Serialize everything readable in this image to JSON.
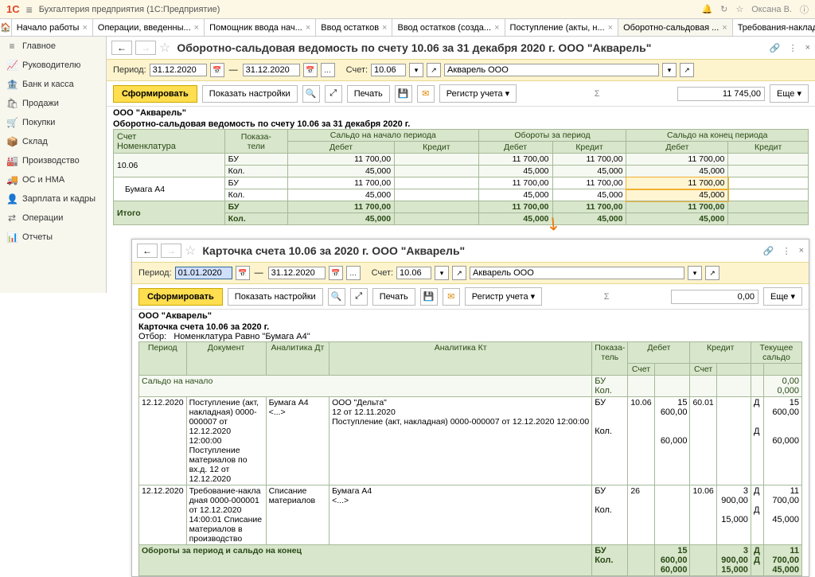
{
  "app": {
    "title": "Бухгалтерия предприятия  (1С:Предприятие)",
    "user": "Оксана В."
  },
  "tabs": [
    "Начало работы",
    "Операции, введенны...",
    "Помощник ввода нач...",
    "Ввод остатков",
    "Ввод остатков (созда...",
    "Поступление (акты, н...",
    "Оборотно-сальдовая ...",
    "Требования-накладные"
  ],
  "sidebar": [
    {
      "icon": "≡",
      "label": "Главное"
    },
    {
      "icon": "📈",
      "label": "Руководителю"
    },
    {
      "icon": "🏦",
      "label": "Банк и касса"
    },
    {
      "icon": "🛍",
      "label": "Продажи"
    },
    {
      "icon": "🛒",
      "label": "Покупки"
    },
    {
      "icon": "📦",
      "label": "Склад"
    },
    {
      "icon": "🏭",
      "label": "Производство"
    },
    {
      "icon": "🚚",
      "label": "ОС и НМА"
    },
    {
      "icon": "👤",
      "label": "Зарплата и кадры"
    },
    {
      "icon": "⇄",
      "label": "Операции"
    },
    {
      "icon": "📊",
      "label": "Отчеты"
    }
  ],
  "rep1": {
    "title": "Оборотно-сальдовая ведомость по счету 10.06 за 31 декабря 2020 г. ООО \"Акварель\"",
    "period_label": "Период:",
    "d1": "31.12.2020",
    "d2": "31.12.2020",
    "acct_label": "Счет:",
    "acct": "10.06",
    "org": "Акварель ООО",
    "btn_form": "Сформировать",
    "btn_sett": "Показать настройки",
    "btn_print": "Печать",
    "btn_reg": "Регистр учета ▾",
    "total": "11 745,00",
    "btn_more": "Еще ▾",
    "org_full": "ООО \"Акварель\"",
    "head2": "Оборотно-сальдовая ведомость по счету 10.06 за 31 декабря 2020 г.",
    "th_acct": "Счет",
    "th_nom": "Номенклатура",
    "th_pok": "Показа-\nтели",
    "th_sn": "Сальдо на начало периода",
    "th_ob": "Обороты за период",
    "th_sk": "Сальдо на конец периода",
    "th_d": "Дебет",
    "th_k": "Кредит",
    "rows": {
      "acct": "10.06",
      "bu": "БУ",
      "kol": "Кол.",
      "paper": "Бумага А4",
      "v_bu": "11 700,00",
      "v_kol": "45,000",
      "itogo": "Итого"
    }
  },
  "rep2": {
    "title": "Карточка счета 10.06 за 2020 г. ООО \"Акварель\"",
    "d1": "01.01.2020",
    "d2": "31.12.2020",
    "period_label": "Период:",
    "acct_label": "Счет:",
    "acct": "10.06",
    "org": "Акварель ООО",
    "btn_form": "Сформировать",
    "btn_sett": "Показать настройки",
    "btn_print": "Печать",
    "btn_reg": "Регистр учета ▾",
    "total": "0,00",
    "btn_more": "Еще ▾",
    "org_full": "ООО \"Акварель\"",
    "head2": "Карточка счета 10.06 за 2020 г.",
    "filter_lbl": "Отбор:",
    "filter": "Номенклатура Равно \"Бумага А4\"",
    "th_per": "Период",
    "th_doc": "Документ",
    "th_adt": "Аналитика Дт",
    "th_akt": "Аналитика Кт",
    "th_pok": "Показа-\nтель",
    "th_deb": "Дебет",
    "th_kre": "Кредит",
    "th_ts": "Текущее сальдо",
    "th_sch": "Счет",
    "sal_beg": "Сальдо на начало",
    "bu": "БУ",
    "kol": "Кол.",
    "sal_beg_v1": "0,00",
    "sal_beg_v2": "0,000",
    "r1": {
      "date": "12.12.2020",
      "doc": "Поступление (акт, накладная) 0000-000007 от 12.12.2020 12:00:00 Поступление материалов по вх.д. 12 от 12.12.2020",
      "adt": "Бумага А4\n<...>",
      "akt": "ООО \"Дельта\"\n12 от 12.11.2020\nПоступление (акт, накладная) 0000-000007 от 12.12.2020 12:00:00",
      "sch_d": "10.06",
      "sum_d": "15 600,00",
      "kol_d": "60,000",
      "sch_k": "60.01",
      "d_flag": "Д",
      "ts1": "15 600,00",
      "ts2": "60,000"
    },
    "r2": {
      "date": "12.12.2020",
      "doc": "Требование-накла дная 0000-000001 от 12.12.2020 14:00:01 Списание материалов в производство",
      "adt": "Списание материалов",
      "akt": "Бумага А4\n<...>",
      "sch_d": "26",
      "sch_k": "10.06",
      "sum_k": "3 900,00",
      "kol_k": "15,000",
      "d_flag": "Д",
      "ts1": "11 700,00",
      "ts2": "45,000"
    },
    "totrow": {
      "label": "Обороты за период и сальдо на конец",
      "d_bu": "15 600,00",
      "d_kol": "60,000",
      "k_bu": "3 900,00",
      "k_kol": "15,000",
      "d_flag": "Д",
      "ts1": "11 700,00",
      "ts2": "45,000"
    }
  }
}
